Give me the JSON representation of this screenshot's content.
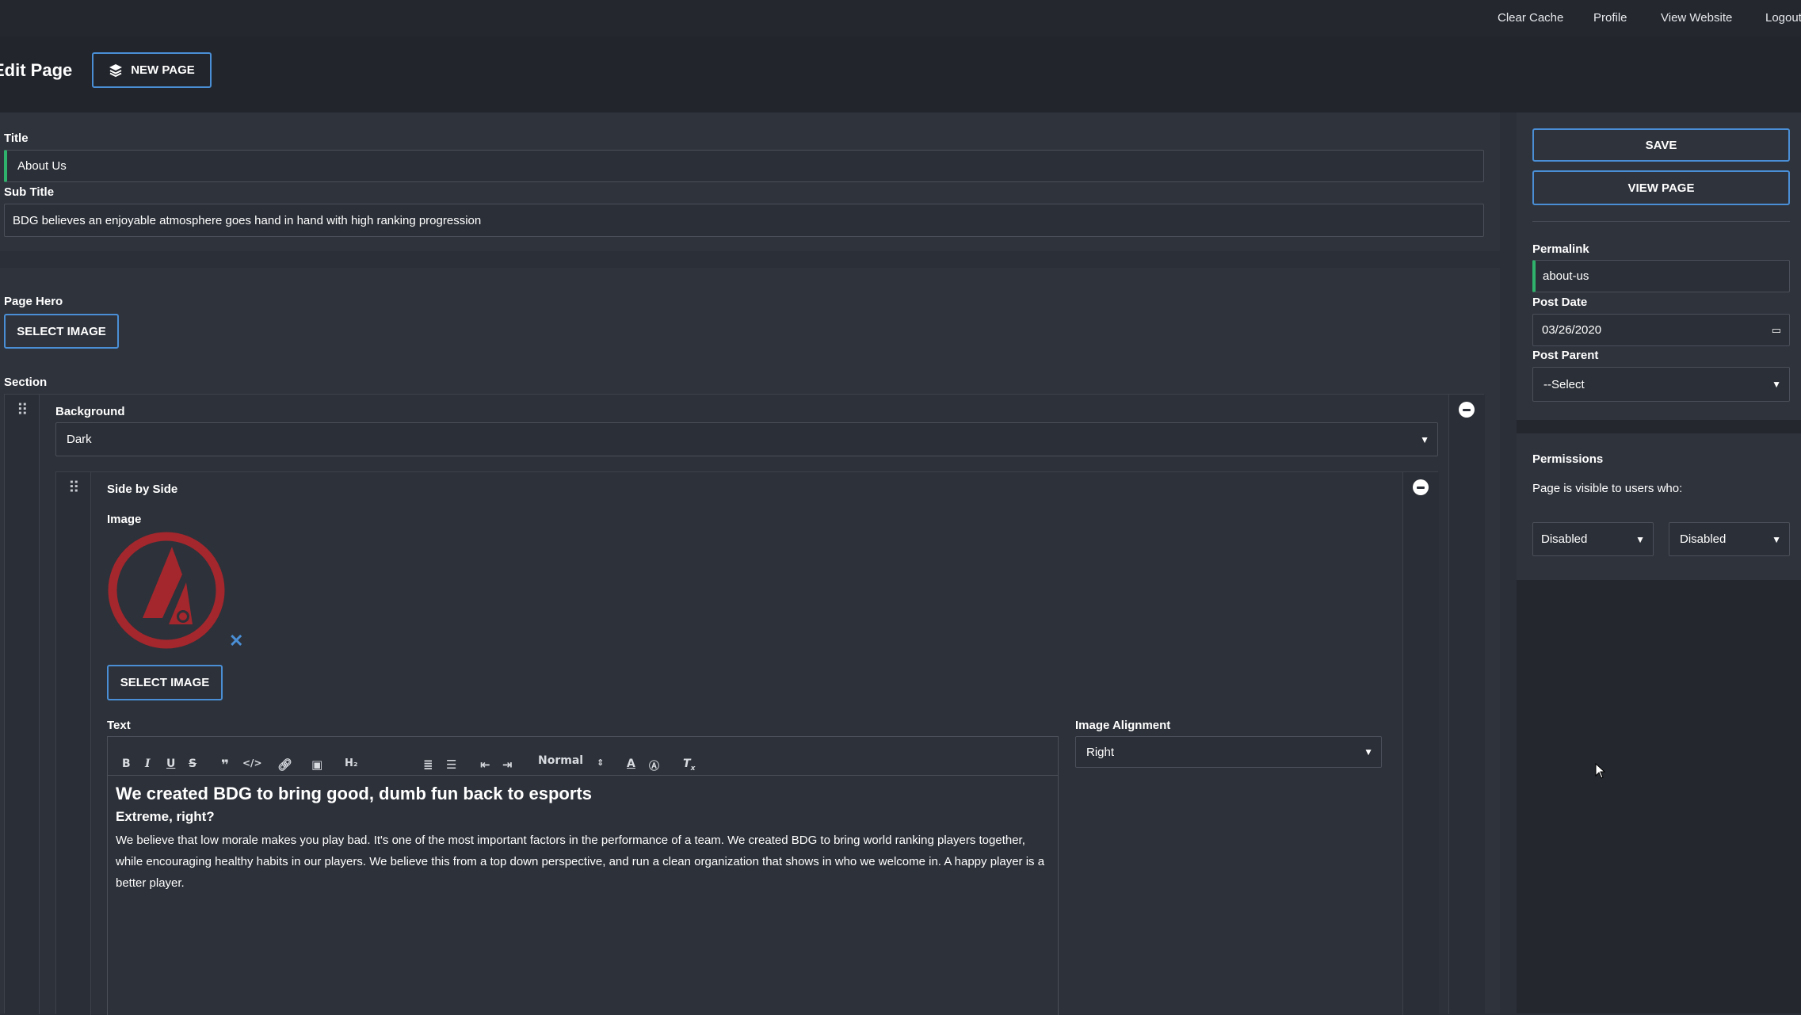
{
  "topbar": {
    "links": [
      "Clear Cache",
      "Profile",
      "View Website",
      "Logout"
    ]
  },
  "header": {
    "title": "Edit Page",
    "new_page_label": "NEW PAGE"
  },
  "main": {
    "title_label": "Title",
    "title_value": "About Us",
    "subtitle_label": "Sub Title",
    "subtitle_value": "BDG believes an enjoyable atmosphere goes hand in hand with high ranking progression",
    "page_hero_label": "Page Hero",
    "select_image_label": "SELECT IMAGE",
    "section_label": "Section",
    "section": {
      "background_label": "Background",
      "background_value": "Dark",
      "block": {
        "title": "Side by Side",
        "image_label": "Image",
        "select_image_label": "SELECT IMAGE",
        "text_label": "Text",
        "image_alignment_label": "Image Alignment",
        "image_alignment_value": "Right",
        "editor": {
          "format_value": "Normal",
          "heading": "We created BDG to bring good, dumb fun back to esports",
          "subheading": "Extreme, right?",
          "paragraph": "We believe that low morale makes you play bad. It's one of the most important factors in the performance of a team. We created BDG to bring world ranking players together, while encouraging healthy habits in our players. We believe this from a top down perspective, and run a clean organization that shows in who we welcome in. A happy player is a better player."
        }
      }
    }
  },
  "sidebar": {
    "save_label": "SAVE",
    "view_page_label": "VIEW PAGE",
    "permalink_label": "Permalink",
    "permalink_value": "about-us",
    "post_date_label": "Post Date",
    "post_date_value": "03/26/2020",
    "post_parent_label": "Post Parent",
    "post_parent_value": "--Select",
    "permissions_title": "Permissions",
    "permissions_text": "Page is visible to users who:",
    "permission_select_1": "Disabled",
    "permission_select_2": "Disabled"
  },
  "colors": {
    "accent_blue": "#4a8fd6",
    "accent_green": "#2fb36c",
    "logo_red": "#a3272d",
    "background": "#2b2f38"
  }
}
